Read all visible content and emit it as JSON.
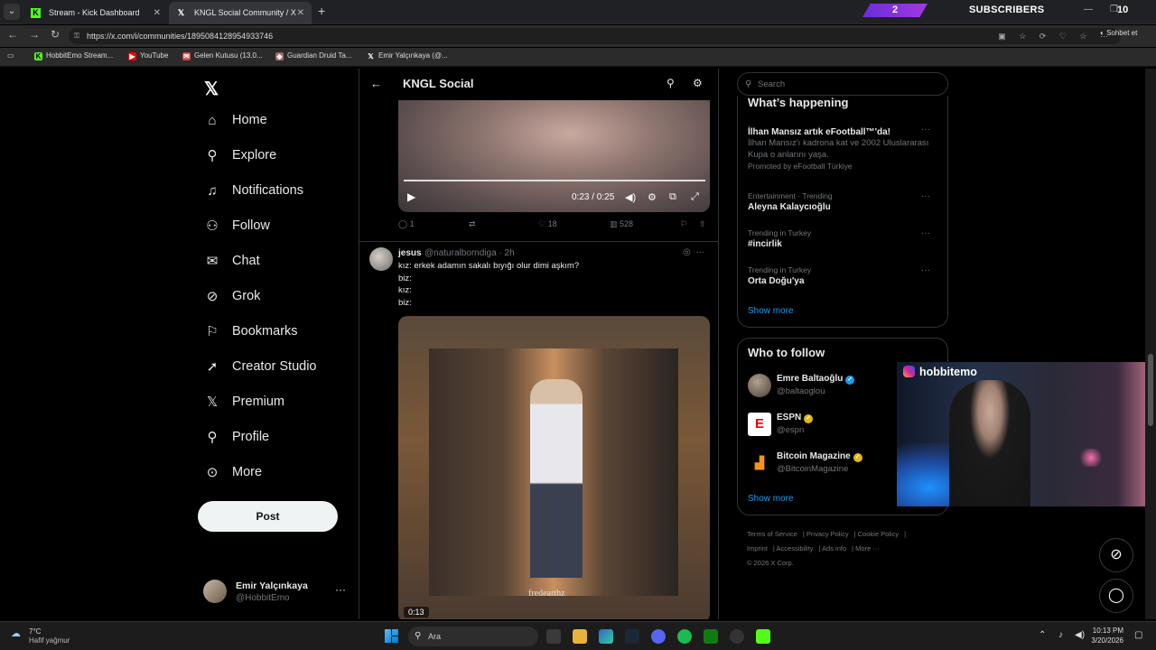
{
  "browser": {
    "tabs": [
      {
        "title": "Stream - Kick Dashboard",
        "icon": "kick-icon"
      },
      {
        "title": "KNGL Social Community / X",
        "icon": "x-icon"
      }
    ],
    "url": "https://x.com/i/communities/1895084128954933746",
    "profile_label": "Sohbet et",
    "bookmarks": [
      "HobbitEmo Stream...",
      "YouTube",
      "Gelen Kutusu (13.0...",
      "Guardian Druid Ta...",
      "Emir Yalçınkaya (@..."
    ]
  },
  "overlay": {
    "subscriber_badge": "2",
    "subscriber_label": "SUBSCRIBERS",
    "subscriber_count": "10",
    "webcam_handle": "hobbitemo"
  },
  "nav": {
    "items": [
      {
        "label": "Home",
        "icon": "home-icon"
      },
      {
        "label": "Explore",
        "icon": "search-icon"
      },
      {
        "label": "Notifications",
        "icon": "bell-icon"
      },
      {
        "label": "Follow",
        "icon": "person-add-icon"
      },
      {
        "label": "Chat",
        "icon": "mail-icon"
      },
      {
        "label": "Grok",
        "icon": "grok-icon"
      },
      {
        "label": "Bookmarks",
        "icon": "bookmark-icon"
      },
      {
        "label": "Creator Studio",
        "icon": "rocket-icon"
      },
      {
        "label": "Premium",
        "icon": "x-icon"
      },
      {
        "label": "Profile",
        "icon": "person-icon"
      },
      {
        "label": "More",
        "icon": "more-circle-icon"
      }
    ],
    "post_label": "Post",
    "account": {
      "name": "Emir Yalçınkaya",
      "handle": "@HobbitEmo"
    }
  },
  "feed": {
    "title": "KNGL Social",
    "video1": {
      "time": "0:23 / 0:25",
      "progress": 0.92,
      "replies": "1",
      "likes": "18",
      "views": "528"
    },
    "tweet": {
      "name": "jesus",
      "handle": "@naturalborndiga",
      "age": "2h",
      "lines": [
        "kız: erkek adamın sakalı bıyığı olur dimi aşkım?",
        "biz:",
        "kız:",
        "biz:"
      ],
      "video_watermark": "fredearthz",
      "video_time": "0:13"
    }
  },
  "sidebar": {
    "search_placeholder": "Search",
    "happening_title": "What’s happening",
    "trends": [
      {
        "title": "İlhan Mansız artık eFootball™'da!",
        "desc": "İlhan Mansız'ı kadrona kat ve 2002 Uluslararası Kupa o anlarını yaşa.",
        "promo": "Promoted by eFootball Türkiye"
      },
      {
        "category": "Entertainment · Trending",
        "title": "Aleyna Kalaycıoğlu"
      },
      {
        "category": "Trending in Turkey",
        "title": "#incirlik"
      },
      {
        "category": "Trending in Turkey",
        "title": "Orta Doğu'ya"
      }
    ],
    "show_more": "Show more",
    "who_to_follow_title": "Who to follow",
    "follow": [
      {
        "name": "Emre Baltaoğlu",
        "handle": "@baltaoglou",
        "badge": "#1d9bf0"
      },
      {
        "name": "ESPN",
        "handle": "@espn",
        "badge": "#e2b719"
      },
      {
        "name": "Bitcoin Magazine",
        "handle": "@BitcoinMagazine",
        "badge": "#e2b719"
      }
    ],
    "footer": [
      "Terms of Service",
      "Privacy Policy",
      "Cookie Policy",
      "Imprint",
      "Accessibility",
      "Ads info",
      "More ···",
      "© 2026 X Corp."
    ]
  },
  "taskbar": {
    "temp": "7°C",
    "weather": "Hafif yağmur",
    "search_placeholder": "Ara",
    "time": "10:13 PM",
    "date": "3/20/2026"
  }
}
